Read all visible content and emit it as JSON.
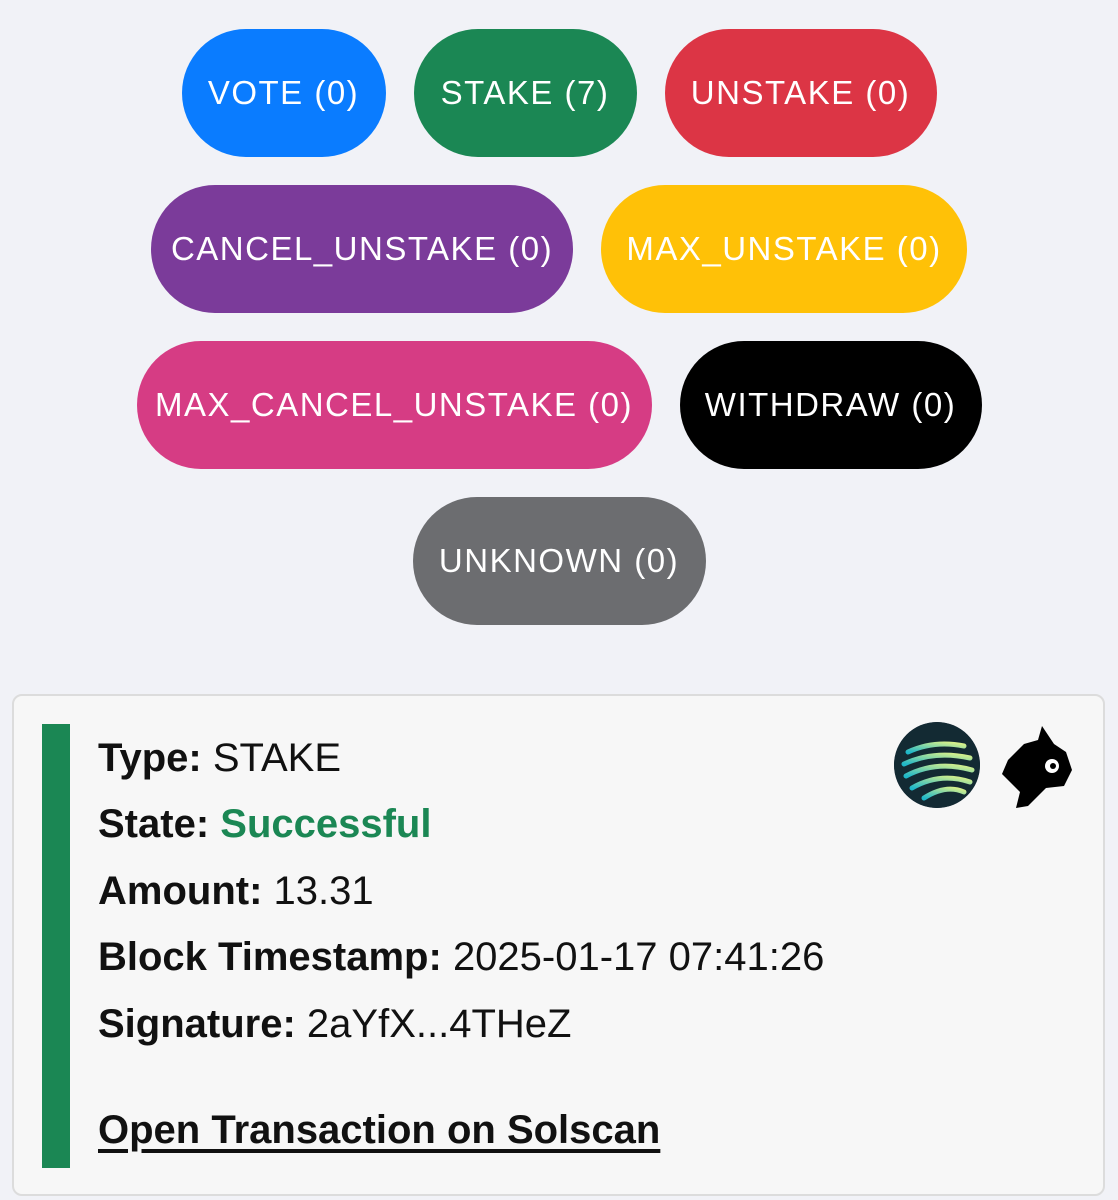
{
  "filters": [
    {
      "label": "VOTE (0)",
      "color": "#0a7cff"
    },
    {
      "label": "STAKE (7)",
      "color": "#1b8754"
    },
    {
      "label": "UNSTAKE (0)",
      "color": "#dc3545"
    },
    {
      "label": "CANCEL_UNSTAKE (0)",
      "color": "#7b3b9a"
    },
    {
      "label": "MAX_UNSTAKE (0)",
      "color": "#ffc107"
    },
    {
      "label": "MAX_CANCEL_UNSTAKE (0)",
      "color": "#d63c84"
    },
    {
      "label": "WITHDRAW (0)",
      "color": "#000000"
    },
    {
      "label": "UNKNOWN (0)",
      "color": "#6c6d70"
    }
  ],
  "transaction": {
    "accent_color": "#1b8754",
    "type_label": "Type:",
    "type_value": "STAKE",
    "state_label": "State:",
    "state_value": "Successful",
    "state_color": "#1b8754",
    "amount_label": "Amount:",
    "amount_value": "13.31",
    "timestamp_label": "Block Timestamp:",
    "timestamp_value": "2025-01-17 07:41:26",
    "signature_label": "Signature:",
    "signature_value": "2aYfX...4THeZ",
    "link_text": "Open Transaction on Solscan",
    "icons": [
      "network-logo-icon",
      "fox-logo-icon"
    ]
  }
}
